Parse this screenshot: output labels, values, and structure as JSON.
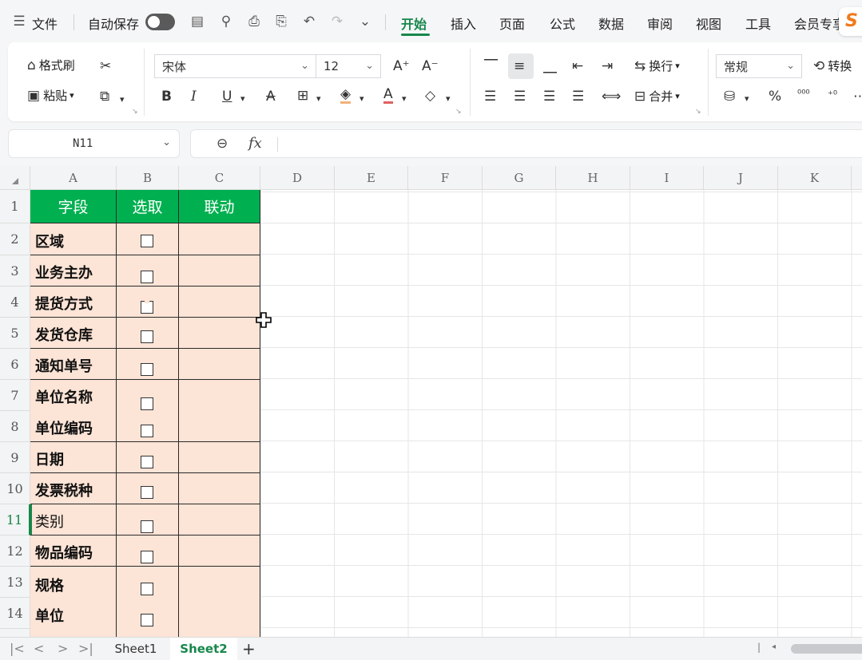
{
  "menu": {
    "file_label": "文件",
    "autosave_label": "自动保存",
    "tabs": [
      {
        "label": "开始",
        "active": true
      },
      {
        "label": "插入",
        "active": false
      },
      {
        "label": "页面",
        "active": false
      },
      {
        "label": "公式",
        "active": false
      },
      {
        "label": "数据",
        "active": false
      },
      {
        "label": "审阅",
        "active": false
      },
      {
        "label": "视图",
        "active": false
      },
      {
        "label": "工具",
        "active": false
      },
      {
        "label": "会员专享",
        "active": false
      }
    ],
    "logo_text": "S",
    "accent_color": "#17874b"
  },
  "ribbon": {
    "format_painter_label": "格式刷",
    "paste_label": "粘贴",
    "font_name": "宋体",
    "font_size": "12",
    "wrap_label": "换行",
    "merge_label": "合并",
    "number_format": "常规",
    "convert_label": "转换"
  },
  "formula_bar": {
    "name_box": "N11",
    "fx_label": "fx",
    "formula": ""
  },
  "sheet": {
    "columns": [
      "A",
      "B",
      "C",
      "D",
      "E",
      "F",
      "G",
      "H",
      "I",
      "J",
      "K"
    ],
    "rows": [
      "1",
      "2",
      "3",
      "4",
      "5",
      "6",
      "7",
      "8",
      "9",
      "10",
      "11",
      "12",
      "13",
      "14"
    ],
    "active_row": "11",
    "header_fill_color": "#00b050",
    "body_fill_color": "#fce4d6",
    "header": [
      "字段",
      "选取",
      "联动"
    ],
    "fields": [
      "区域",
      "业务主办",
      "提货方式",
      "发货仓库",
      "通知单号",
      "单位名称",
      "单位编码",
      "日期",
      "发票税种",
      "类别",
      "物品编码",
      "规格",
      "单位"
    ],
    "checked": [
      false,
      false,
      false,
      false,
      false,
      false,
      false,
      false,
      false,
      false,
      false,
      false,
      false
    ]
  },
  "sheet_tabs": [
    {
      "label": "Sheet1",
      "active": false
    },
    {
      "label": "Sheet2",
      "active": true
    }
  ],
  "add_sheet_label": "+"
}
